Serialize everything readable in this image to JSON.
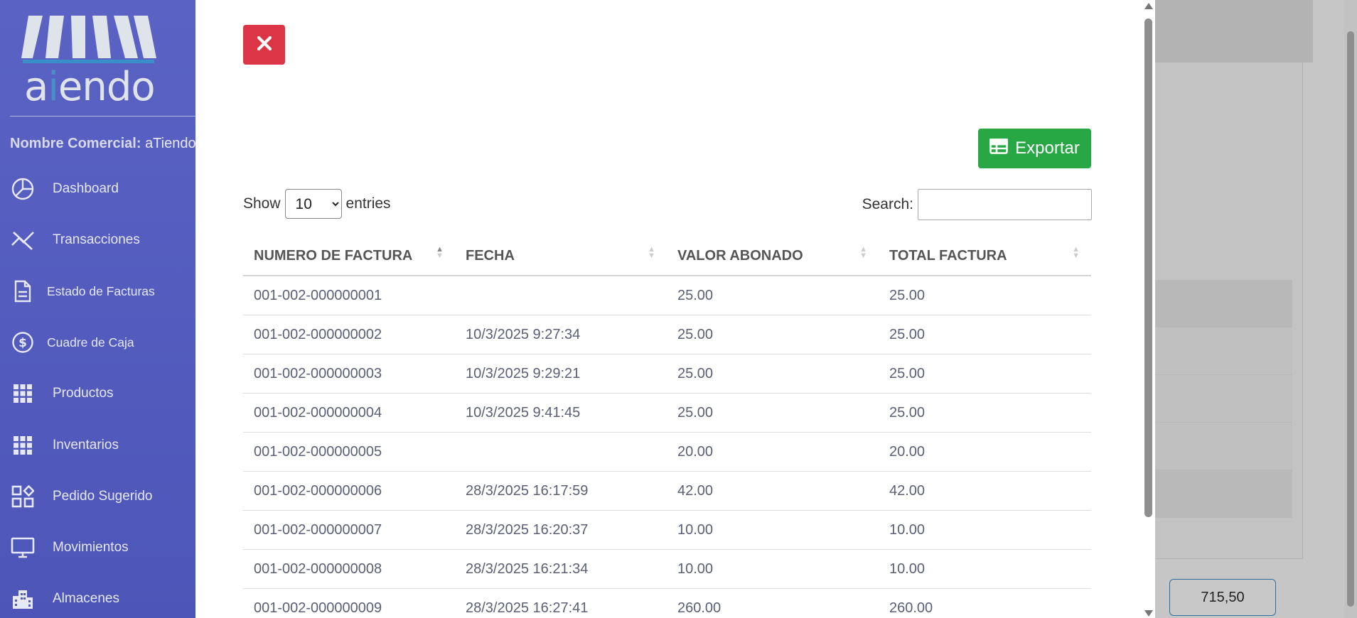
{
  "sidebar": {
    "logo_text_a": "a",
    "logo_text_i": "i",
    "logo_text_rest": "endo",
    "brand_label": "Nombre Comercial:",
    "brand_value": "aTiendo",
    "items": [
      {
        "label": "Dashboard",
        "icon": "pie-chart-icon"
      },
      {
        "label": "Transacciones",
        "icon": "transactions-icon"
      },
      {
        "label": "Estado de Facturas",
        "icon": "document-icon"
      },
      {
        "label": "Cuadre de Caja",
        "icon": "dollar-circle-icon"
      },
      {
        "label": "Productos",
        "icon": "grid-icon"
      },
      {
        "label": "Inventarios",
        "icon": "grid-icon"
      },
      {
        "label": "Pedido Sugerido",
        "icon": "widgets-icon"
      },
      {
        "label": "Movimientos",
        "icon": "monitor-icon"
      },
      {
        "label": "Almacenes",
        "icon": "buildings-icon"
      }
    ]
  },
  "modal": {
    "export_label": "Exportar",
    "show_label": "Show",
    "entries_label": "entries",
    "page_size": "10",
    "page_size_options": [
      "10"
    ],
    "search_label": "Search:",
    "search_value": "",
    "columns": [
      "NUMERO DE FACTURA",
      "FECHA",
      "VALOR ABONADO",
      "TOTAL FACTURA"
    ],
    "rows": [
      [
        "001-002-000000001",
        "",
        "25.00",
        "25.00"
      ],
      [
        "001-002-000000002",
        "10/3/2025 9:27:34",
        "25.00",
        "25.00"
      ],
      [
        "001-002-000000003",
        "10/3/2025 9:29:21",
        "25.00",
        "25.00"
      ],
      [
        "001-002-000000004",
        "10/3/2025 9:41:45",
        "25.00",
        "25.00"
      ],
      [
        "001-002-000000005",
        "",
        "20.00",
        "20.00"
      ],
      [
        "001-002-000000006",
        "28/3/2025 16:17:59",
        "42.00",
        "42.00"
      ],
      [
        "001-002-000000007",
        "28/3/2025 16:20:37",
        "10.00",
        "10.00"
      ],
      [
        "001-002-000000008",
        "28/3/2025 16:21:34",
        "10.00",
        "10.00"
      ],
      [
        "001-002-000000009",
        "28/3/2025 16:27:41",
        "260.00",
        "260.00"
      ]
    ]
  },
  "background": {
    "total_value": "715,50"
  },
  "colors": {
    "sidebar": "#5a63c4",
    "close_button": "#dc3545",
    "export_button": "#28a745"
  }
}
